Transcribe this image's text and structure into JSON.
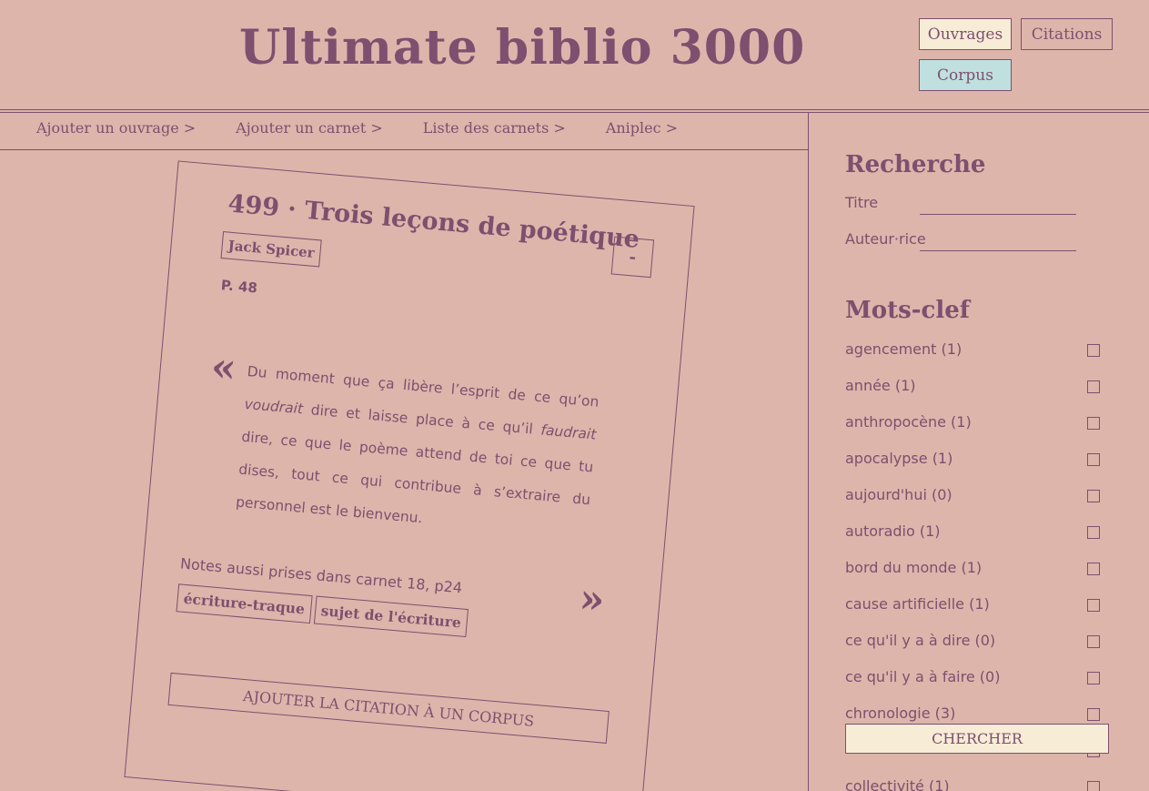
{
  "header": {
    "title": "Ultimate biblio 3000",
    "nav": {
      "ouvrages": "Ouvrages",
      "citations": "Citations",
      "corpus": "Corpus"
    }
  },
  "subnav": {
    "add_book": "Ajouter un ouvrage >",
    "add_notebook": "Ajouter un carnet >",
    "notebook_list": "Liste des carnets >",
    "aniplec": "Aniplec >"
  },
  "card": {
    "title": "499 · Trois leçons de poétique",
    "author": "Jack Spicer",
    "minus": "-",
    "page": "P. 48",
    "quote_open": "«",
    "quote_close": "»",
    "quote": {
      "p1": "Du moment que ça libère l’esprit de ce qu’on ",
      "i1": "voudrait",
      "p2": " dire et laisse place à ce qu’il ",
      "i2": "faudrait",
      "p3": " dire, ce que le poème attend de toi ce que tu dises, tout ce qui contribue à s’extraire du personnel est le bienvenu."
    },
    "note": "Notes aussi prises dans carnet 18, p24",
    "tags": [
      "écriture-traque",
      "sujet de l'écriture"
    ],
    "add_to_corpus": "AJOUTER LA CITATION À UN CORPUS"
  },
  "sidebar": {
    "search_heading": "Recherche",
    "title_label": "Titre",
    "author_label": "Auteur·rice",
    "title_value": "",
    "author_value": "",
    "keywords_heading": "Mots-clef",
    "keywords": [
      "agencement (1)",
      "année (1)",
      "anthropocène (1)",
      "apocalypse (1)",
      "aujourd'hui (0)",
      "autoradio (1)",
      "bord du monde (1)",
      "cause artificielle (1)",
      "ce qu'il y a à dire (0)",
      "ce qu'il y a à faire (0)",
      "chronologie (3)",
      "",
      "collectivité (1)"
    ],
    "search_button": "CHERCHER"
  },
  "colors": {
    "background": "#deb5ab",
    "ink": "#7e4f6e",
    "ouvrages_active": "#f7ecd6",
    "corpus_bg": "#bfe0df"
  }
}
